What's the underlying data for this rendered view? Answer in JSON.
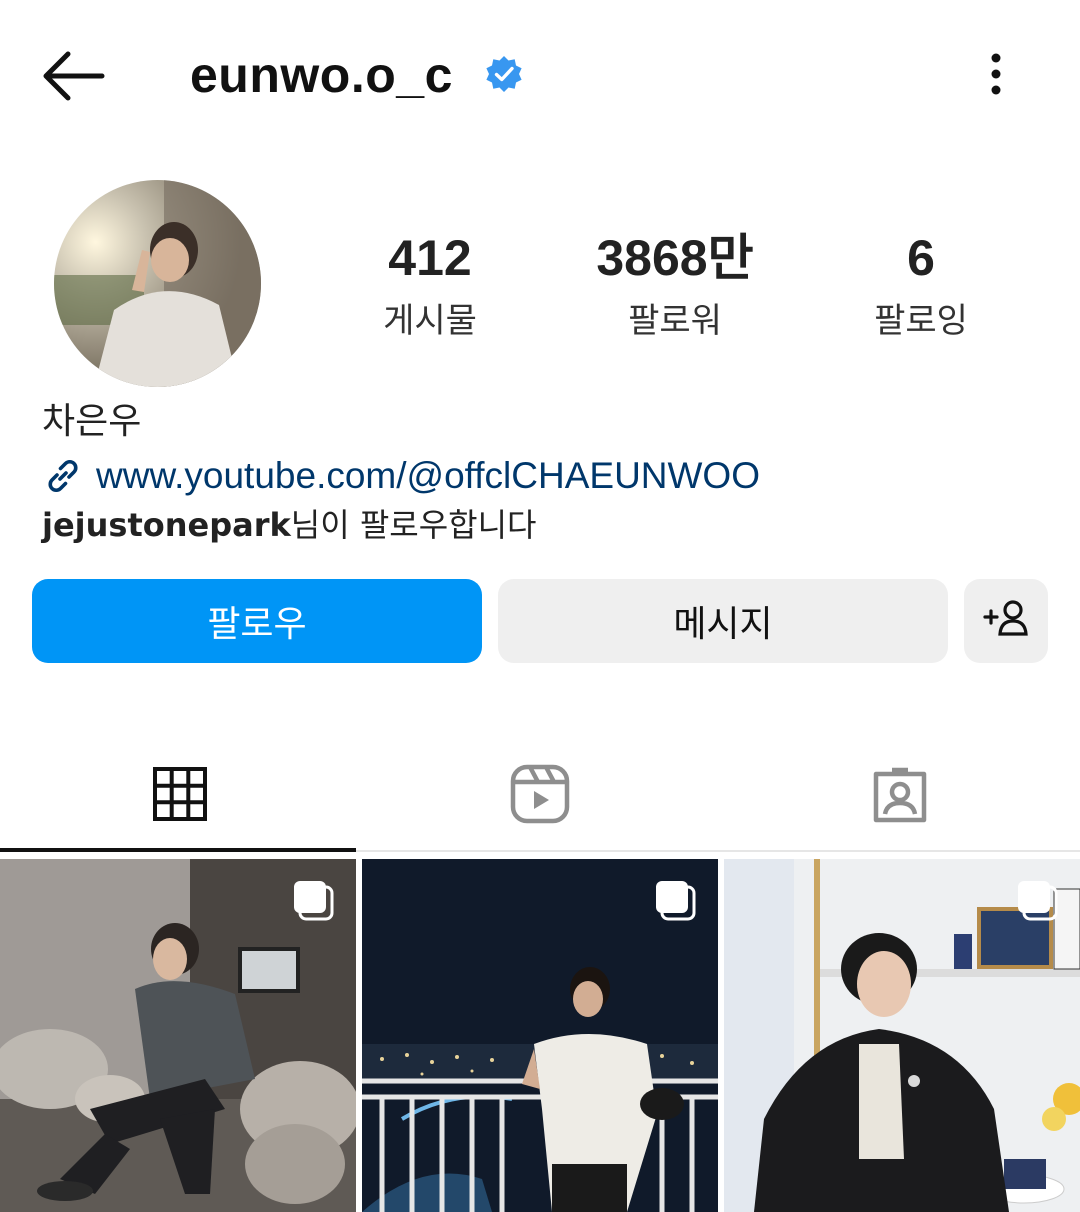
{
  "header": {
    "username": "eunwo.o_c",
    "verified_color": "#3897f0"
  },
  "profile": {
    "stats": {
      "posts_count": "412",
      "posts_label": "게시물",
      "followers_count": "3868만",
      "followers_label": "팔로워",
      "following_count": "6",
      "following_label": "팔로잉"
    },
    "full_name": "차은우",
    "link": "www.youtube.com/@offclCHAEUNWOO",
    "followed_by_user": "jejustonepark",
    "followed_by_suffix": "님이 팔로우합니다"
  },
  "actions": {
    "follow_label": "팔로우",
    "message_label": "메시지"
  },
  "tabs": [
    {
      "name": "grid-icon",
      "active": true
    },
    {
      "name": "reels-icon",
      "active": false
    },
    {
      "name": "tagged-icon",
      "active": false
    }
  ],
  "colors": {
    "accent": "#0095f6",
    "link": "#00376b",
    "button_secondary": "#efefef"
  }
}
